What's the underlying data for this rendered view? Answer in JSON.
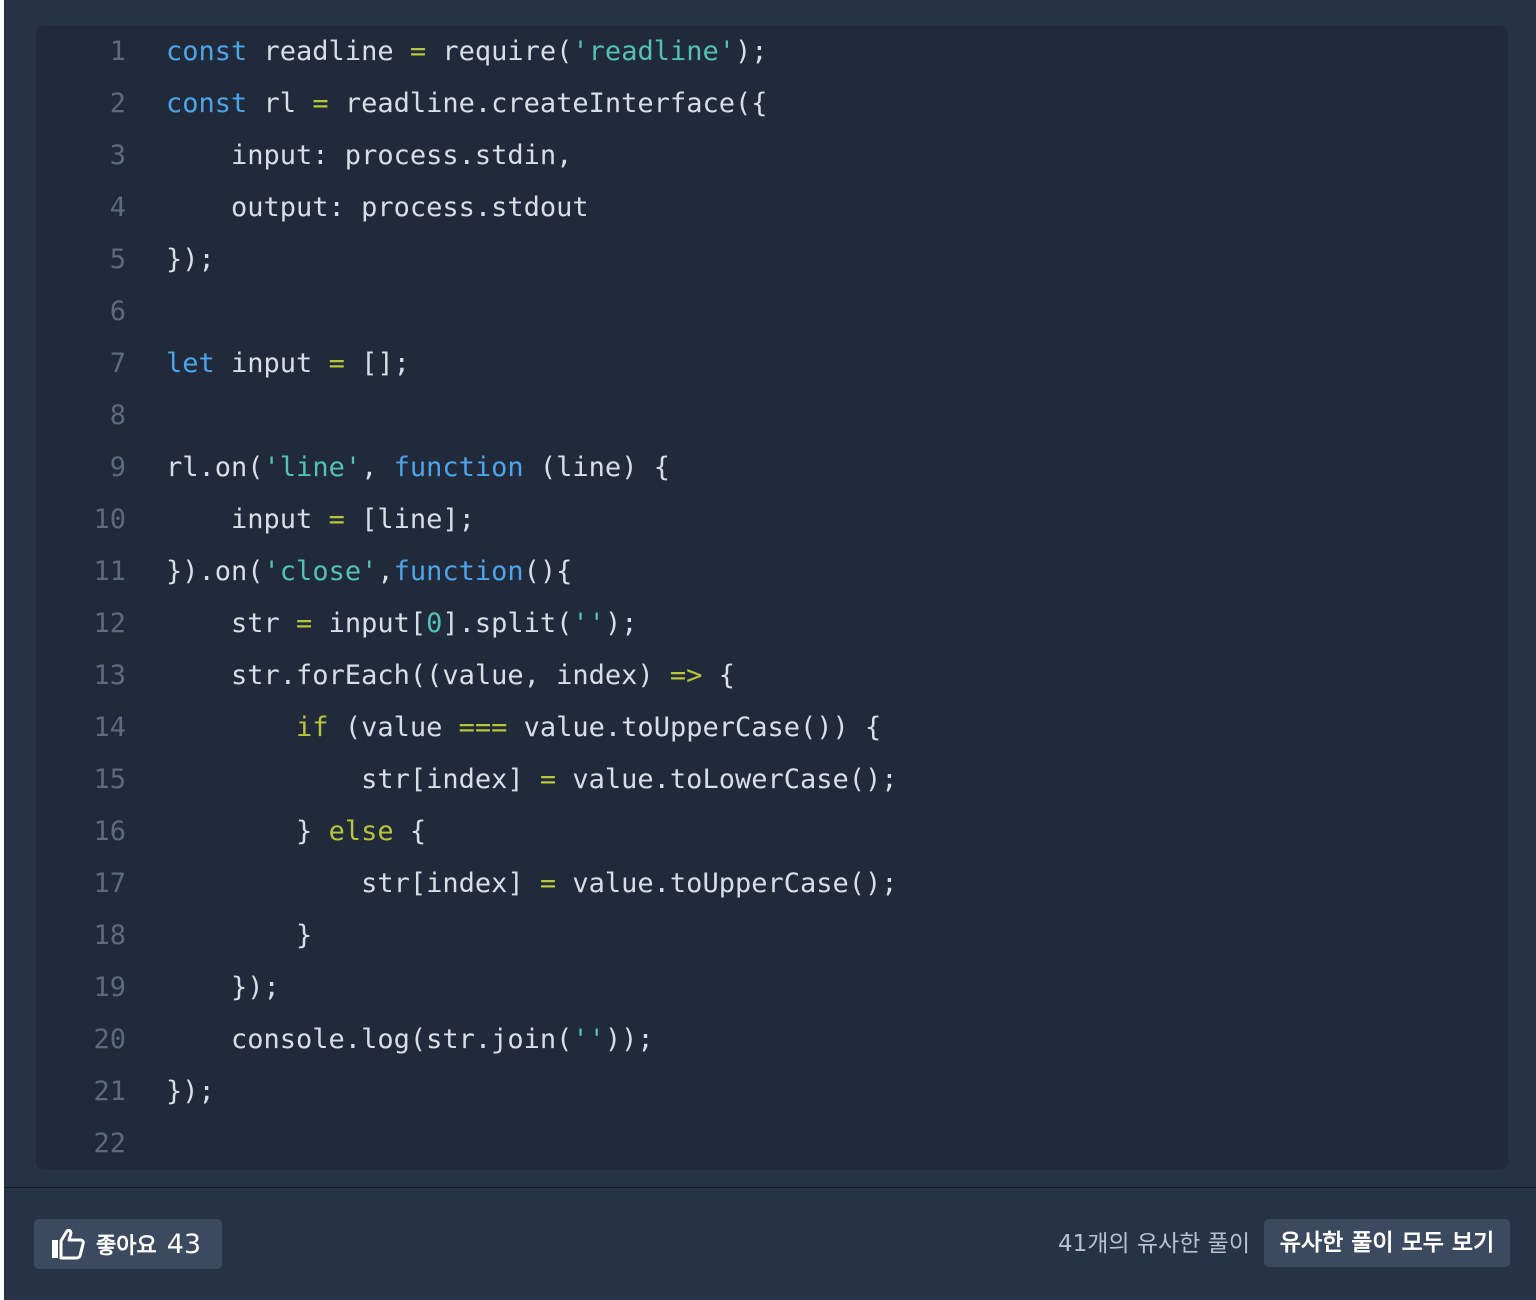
{
  "code": {
    "lines": [
      {
        "num": "1",
        "tokens": [
          {
            "t": "kw",
            "v": "const"
          },
          {
            "t": "",
            "v": " readline "
          },
          {
            "t": "op",
            "v": "="
          },
          {
            "t": "",
            "v": " require("
          },
          {
            "t": "str",
            "v": "'readline'"
          },
          {
            "t": "",
            "v": ");"
          }
        ]
      },
      {
        "num": "2",
        "tokens": [
          {
            "t": "kw",
            "v": "const"
          },
          {
            "t": "",
            "v": " rl "
          },
          {
            "t": "op",
            "v": "="
          },
          {
            "t": "",
            "v": " readline.createInterface({"
          }
        ]
      },
      {
        "num": "3",
        "tokens": [
          {
            "t": "",
            "v": "    input: process.stdin,"
          }
        ]
      },
      {
        "num": "4",
        "tokens": [
          {
            "t": "",
            "v": "    output: process.stdout"
          }
        ]
      },
      {
        "num": "5",
        "tokens": [
          {
            "t": "",
            "v": "});"
          }
        ]
      },
      {
        "num": "6",
        "tokens": []
      },
      {
        "num": "7",
        "tokens": [
          {
            "t": "kw",
            "v": "let"
          },
          {
            "t": "",
            "v": " input "
          },
          {
            "t": "op",
            "v": "="
          },
          {
            "t": "",
            "v": " [];"
          }
        ]
      },
      {
        "num": "8",
        "tokens": []
      },
      {
        "num": "9",
        "tokens": [
          {
            "t": "",
            "v": "rl.on("
          },
          {
            "t": "str",
            "v": "'line'"
          },
          {
            "t": "",
            "v": ", "
          },
          {
            "t": "kw",
            "v": "function"
          },
          {
            "t": "",
            "v": " (line) {"
          }
        ]
      },
      {
        "num": "10",
        "tokens": [
          {
            "t": "",
            "v": "    input "
          },
          {
            "t": "op",
            "v": "="
          },
          {
            "t": "",
            "v": " [line];"
          }
        ]
      },
      {
        "num": "11",
        "tokens": [
          {
            "t": "",
            "v": "}).on("
          },
          {
            "t": "str",
            "v": "'close'"
          },
          {
            "t": "",
            "v": ","
          },
          {
            "t": "kw",
            "v": "function"
          },
          {
            "t": "",
            "v": "(){"
          }
        ]
      },
      {
        "num": "12",
        "tokens": [
          {
            "t": "",
            "v": "    str "
          },
          {
            "t": "op",
            "v": "="
          },
          {
            "t": "",
            "v": " input["
          },
          {
            "t": "num",
            "v": "0"
          },
          {
            "t": "",
            "v": "].split("
          },
          {
            "t": "str",
            "v": "''"
          },
          {
            "t": "",
            "v": ");"
          }
        ]
      },
      {
        "num": "13",
        "tokens": [
          {
            "t": "",
            "v": "    str.forEach((value, index) "
          },
          {
            "t": "op",
            "v": "=>"
          },
          {
            "t": "",
            "v": " {"
          }
        ]
      },
      {
        "num": "14",
        "tokens": [
          {
            "t": "",
            "v": "        "
          },
          {
            "t": "ctl",
            "v": "if"
          },
          {
            "t": "",
            "v": " (value "
          },
          {
            "t": "op",
            "v": "==="
          },
          {
            "t": "",
            "v": " value.toUpperCase()) {"
          }
        ]
      },
      {
        "num": "15",
        "tokens": [
          {
            "t": "",
            "v": "            str[index] "
          },
          {
            "t": "op",
            "v": "="
          },
          {
            "t": "",
            "v": " value.toLowerCase();"
          }
        ]
      },
      {
        "num": "16",
        "tokens": [
          {
            "t": "",
            "v": "        } "
          },
          {
            "t": "ctl",
            "v": "else"
          },
          {
            "t": "",
            "v": " {"
          }
        ]
      },
      {
        "num": "17",
        "tokens": [
          {
            "t": "",
            "v": "            str[index] "
          },
          {
            "t": "op",
            "v": "="
          },
          {
            "t": "",
            "v": " value.toUpperCase();"
          }
        ]
      },
      {
        "num": "18",
        "tokens": [
          {
            "t": "",
            "v": "        }"
          }
        ]
      },
      {
        "num": "19",
        "tokens": [
          {
            "t": "",
            "v": "    });"
          }
        ]
      },
      {
        "num": "20",
        "tokens": [
          {
            "t": "",
            "v": "    console.log(str.join("
          },
          {
            "t": "str",
            "v": "''"
          },
          {
            "t": "",
            "v": "));"
          }
        ]
      },
      {
        "num": "21",
        "tokens": [
          {
            "t": "",
            "v": "});"
          }
        ]
      },
      {
        "num": "22",
        "tokens": []
      }
    ]
  },
  "footer": {
    "like_label": "좋아요",
    "like_count": "43",
    "like_icon": "thumbs-up-icon",
    "similar_count_text": "41개의 유사한 풀이",
    "view_all_label": "유사한 풀이 모두 보기"
  },
  "colors": {
    "card_bg": "#263245",
    "code_bg": "#202a3b",
    "keyword": "#4ea4e8",
    "control": "#b7c53a",
    "string": "#53c1b5",
    "button_bg": "#3c4a5f"
  }
}
